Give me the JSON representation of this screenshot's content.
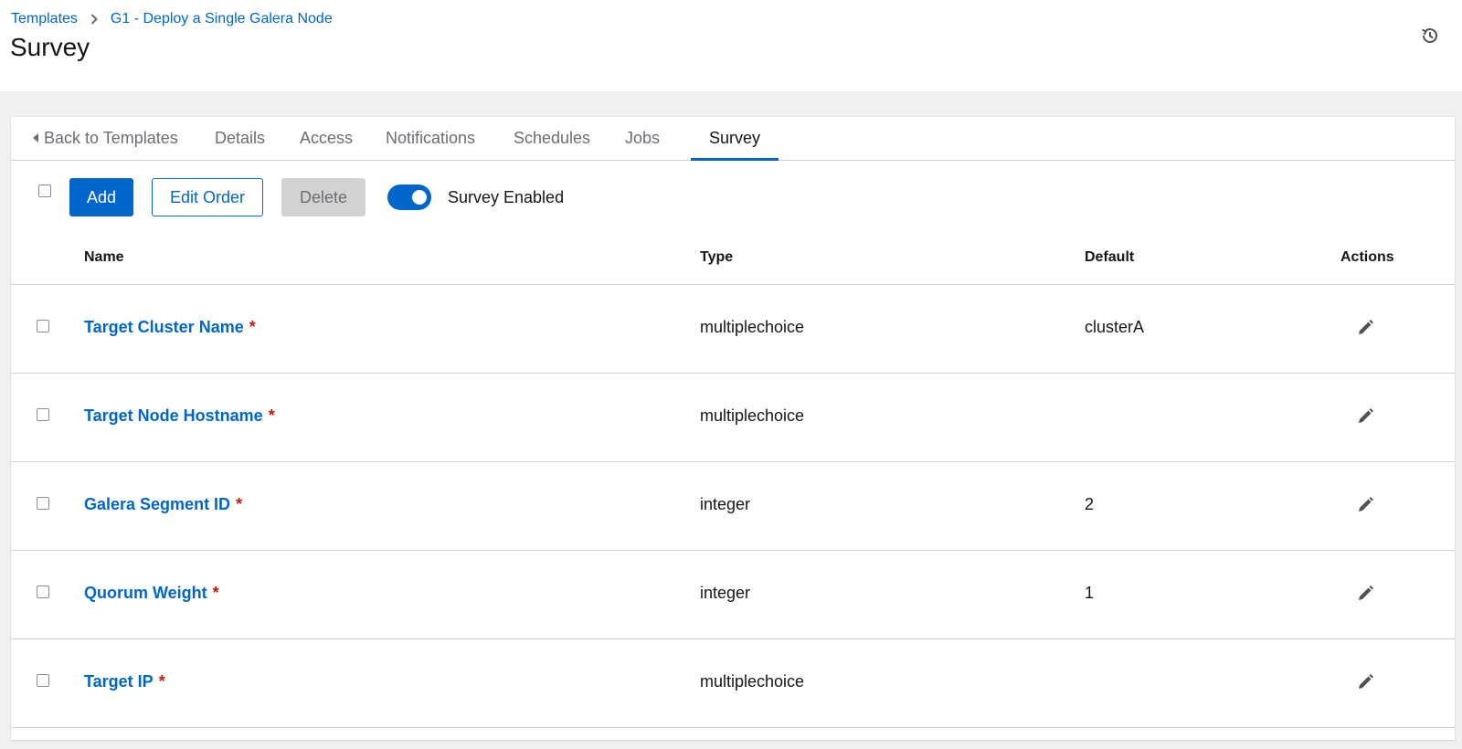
{
  "breadcrumb": {
    "items": [
      "Templates",
      "G1 - Deploy a Single Galera Node"
    ]
  },
  "page": {
    "title": "Survey"
  },
  "header_icons": {
    "history": "history-icon"
  },
  "tabs": [
    {
      "label": "Back to Templates"
    },
    {
      "label": "Details"
    },
    {
      "label": "Access"
    },
    {
      "label": "Notifications"
    },
    {
      "label": "Schedules"
    },
    {
      "label": "Jobs"
    },
    {
      "label": "Survey",
      "active": true
    }
  ],
  "toolbar": {
    "add_label": "Add",
    "edit_order_label": "Edit Order",
    "delete_label": "Delete",
    "survey_enabled_label": "Survey Enabled",
    "survey_enabled": true
  },
  "table": {
    "columns": [
      "Name",
      "Type",
      "Default",
      "Actions"
    ],
    "rows": [
      {
        "name": "Target Cluster Name",
        "required": "*",
        "type": "multiplechoice",
        "default": "clusterA"
      },
      {
        "name": "Target Node Hostname",
        "required": "*",
        "type": "multiplechoice",
        "default": ""
      },
      {
        "name": "Galera Segment ID",
        "required": "*",
        "type": "integer",
        "default": "2"
      },
      {
        "name": "Quorum Weight",
        "required": "*",
        "type": "integer",
        "default": "1"
      },
      {
        "name": "Target IP",
        "required": "*",
        "type": "multiplechoice",
        "default": ""
      }
    ]
  },
  "colors": {
    "accent": "#0066cc",
    "required": "#c9190b",
    "background": "#f0f0f0"
  }
}
